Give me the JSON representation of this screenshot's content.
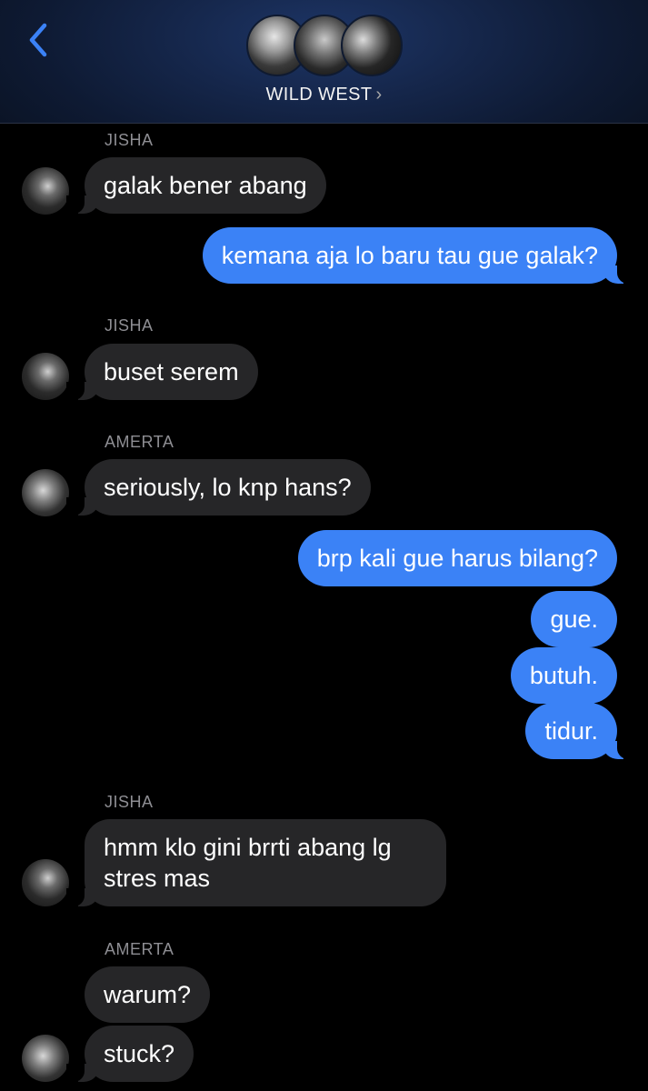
{
  "header": {
    "back_icon": "chevron-left-icon",
    "group_name": "WILD WEST",
    "name_chevron": "›",
    "accent": "#3b82f6"
  },
  "messages": [
    {
      "sender": "JISHA",
      "direction": "incoming",
      "text": "galak bener abang"
    },
    {
      "direction": "outgoing",
      "text": "kemana aja lo baru tau gue galak?"
    },
    {
      "sender": "JISHA",
      "direction": "incoming",
      "text": "buset serem"
    },
    {
      "sender": "AMERTA",
      "direction": "incoming",
      "text": "seriously, lo knp hans?"
    },
    {
      "direction": "outgoing",
      "text": "brp kali gue harus bilang?"
    },
    {
      "direction": "outgoing",
      "text": "gue."
    },
    {
      "direction": "outgoing",
      "text": "butuh."
    },
    {
      "direction": "outgoing",
      "text": "tidur."
    },
    {
      "sender": "JISHA",
      "direction": "incoming",
      "text": "hmm klo gini brrti abang lg stres mas"
    },
    {
      "sender": "AMERTA",
      "direction": "incoming",
      "text": "warum?"
    },
    {
      "direction": "incoming",
      "text": "stuck?"
    }
  ],
  "colors": {
    "incoming_bubble": "#262628",
    "outgoing_bubble": "#3b82f6",
    "sender_label": "#8e8e93"
  }
}
